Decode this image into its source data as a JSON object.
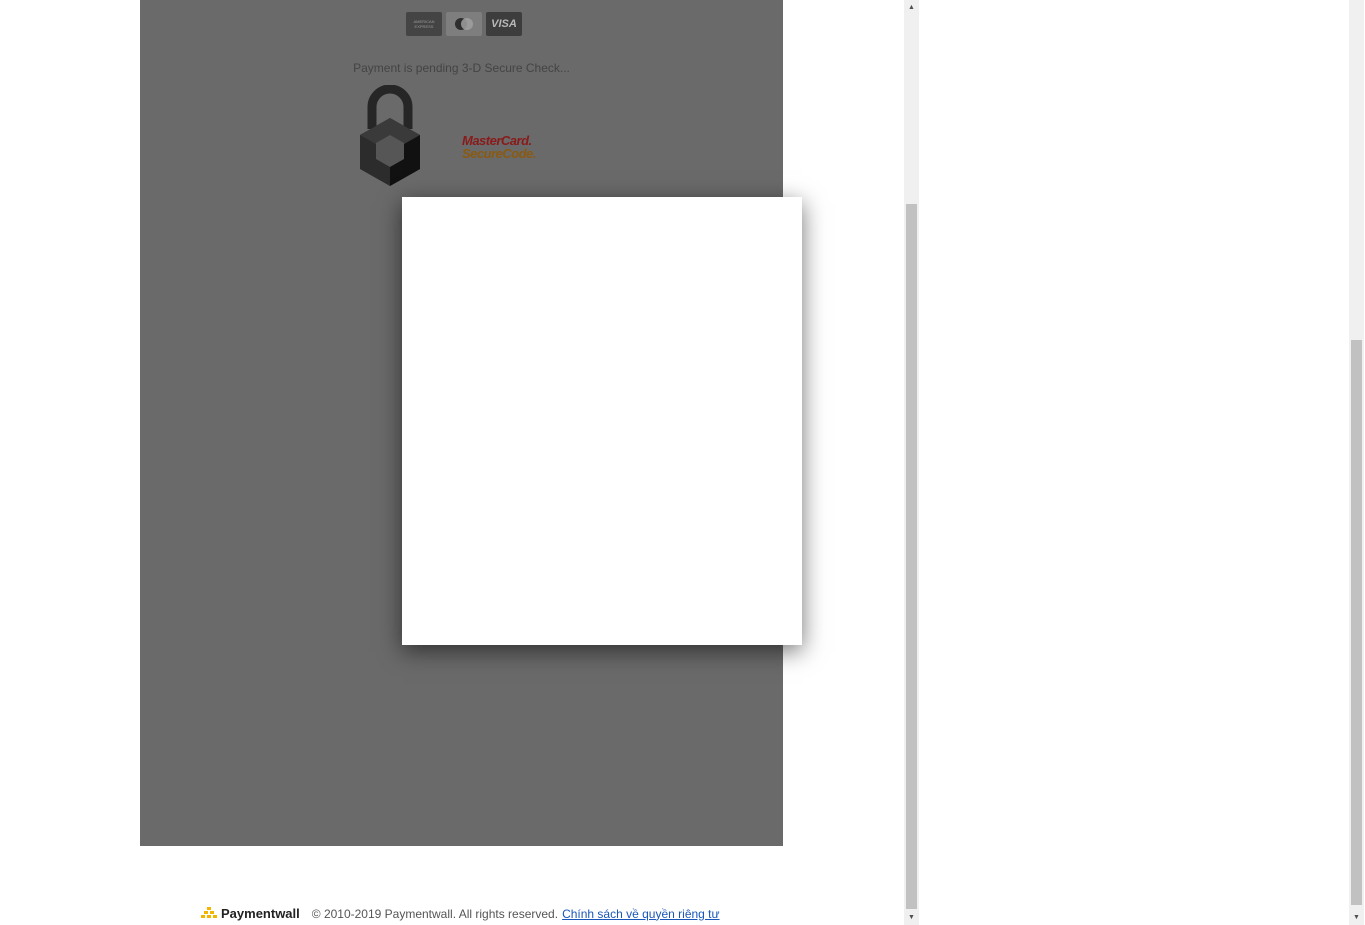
{
  "card_icons": [
    {
      "name": "amex",
      "line1": "AMERICAN",
      "line2": "EXPRESS"
    },
    {
      "name": "mastercard"
    },
    {
      "name": "visa",
      "label": "VISA"
    }
  ],
  "status": {
    "pending_text": "Payment is pending 3-D Secure Check..."
  },
  "secure_code": {
    "line1": "MasterCard.",
    "line2": "SecureCode."
  },
  "footer": {
    "brand": "Paymentwall",
    "copyright": "© 2010-2019 Paymentwall. All rights reserved.",
    "privacy_link": "Chính sách về quyền riêng tư"
  },
  "colors": {
    "overlay": "#6a6a6a",
    "brand_accent": "#f2b600",
    "link": "#1a56b8"
  },
  "icons": [
    "padlock-icon",
    "amex-icon",
    "mastercard-icon",
    "visa-icon",
    "paymentwall-logo-icon",
    "scroll-up-arrow-icon",
    "scroll-down-arrow-icon"
  ]
}
